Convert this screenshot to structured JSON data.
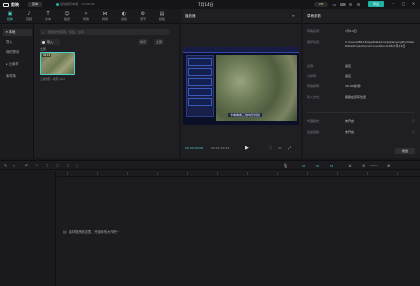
{
  "titlebar": {
    "app_name": "剪映",
    "menu_label": "菜单",
    "auto_save": "自动保存本地：14:09:06",
    "title": "7月14日",
    "vip": "VIP",
    "export_label": "导出"
  },
  "media_tabs": [
    {
      "label": "媒体",
      "icon": "▣"
    },
    {
      "label": "音频",
      "icon": "♪"
    },
    {
      "label": "文本",
      "icon": "T"
    },
    {
      "label": "贴纸",
      "icon": "☺"
    },
    {
      "label": "特效",
      "icon": "✧"
    },
    {
      "label": "转场",
      "icon": "⋈"
    },
    {
      "label": "滤镜",
      "icon": "◐"
    },
    {
      "label": "调节",
      "icon": "⚙"
    },
    {
      "label": "模板",
      "icon": "▤"
    }
  ],
  "media_side": [
    {
      "label": "▾ 本地"
    },
    {
      "label": "导入"
    },
    {
      "label": "我的预设"
    },
    {
      "label": "▸ 云素材"
    },
    {
      "label": "素材库"
    }
  ],
  "media": {
    "search_placeholder": "搜索文件名称、标签、台词",
    "import_label": "导入",
    "sort_label": "排序",
    "filter_label": "全部",
    "section_label": "全部",
    "thumb_duration": "00:10",
    "thumb_name": "三维地形—地形.mp4"
  },
  "player": {
    "title": "播放器",
    "caption": "卡看看看三维地形视频",
    "time_current": "00:00:00:00",
    "time_total": "00:01:23:23"
  },
  "props": {
    "title": "草稿参数",
    "rows": [
      {
        "key": "草稿名称：",
        "value": "7月14日"
      },
      {
        "key": "保存位置：",
        "value": "C:/Users/8613/AppData/Local/JianyingPro/User Data/Projects/com.lveditor.draft/7月14日"
      },
      {
        "key": "比例：",
        "value": "适应"
      },
      {
        "key": "分辨率：",
        "value": "适应"
      },
      {
        "key": "草稿帧率：",
        "value": "30.00帧/秒"
      },
      {
        "key": "导入方式：",
        "value": "保留在原有位置"
      },
      {
        "key": "代理模式：",
        "value": "未开启"
      },
      {
        "key": "自由层级：",
        "value": "未开启"
      }
    ],
    "modify_label": "修改"
  },
  "timeline": {
    "hint": "素材拖拽到这里，开始你的大作吧~"
  }
}
